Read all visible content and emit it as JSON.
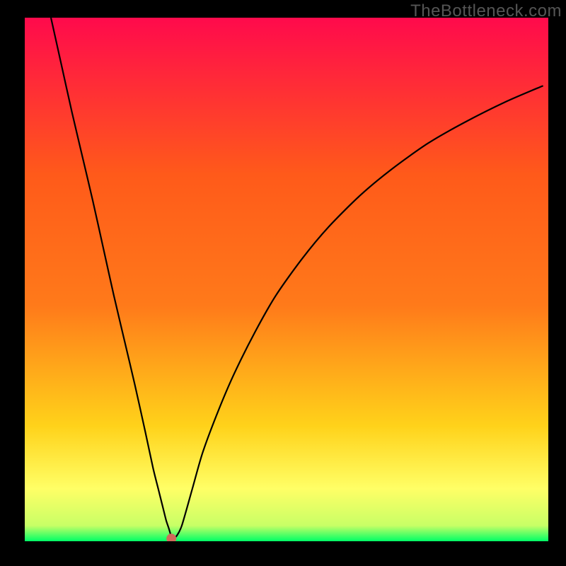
{
  "watermark": "TheBottleneck.com",
  "chart_data": {
    "type": "line",
    "title": "",
    "xlabel": "",
    "ylabel": "",
    "xlim": [
      0,
      100
    ],
    "ylim": [
      0,
      100
    ],
    "background_gradient": {
      "top": "#ff0a4c",
      "upper_mid": "#ff7a1a",
      "mid": "#ffd21a",
      "lower_mid": "#ffff66",
      "bottom": "#00ff66"
    },
    "series": [
      {
        "name": "bottleneck-curve",
        "color": "#000000",
        "x": [
          5,
          7,
          9,
          11,
          13,
          15,
          17,
          19,
          21,
          23,
          24.5,
          25.5,
          26,
          26.5,
          27,
          27.5,
          27.8,
          28,
          28.5,
          29,
          30,
          32,
          34,
          37,
          40,
          44,
          48,
          53,
          58,
          64,
          70,
          77,
          84,
          92,
          99
        ],
        "y": [
          100,
          91,
          82,
          73.5,
          65,
          56,
          47,
          38.5,
          30,
          21,
          14,
          10,
          8,
          6,
          4,
          2.5,
          1.5,
          1,
          0.8,
          1,
          3,
          10,
          17,
          25,
          32,
          40,
          47,
          54,
          60,
          66,
          71,
          76,
          80,
          84,
          87
        ]
      }
    ],
    "marker": {
      "name": "optimal-point",
      "x": 28,
      "y": 0.5,
      "color": "#d06a5a",
      "radius": 7
    }
  }
}
